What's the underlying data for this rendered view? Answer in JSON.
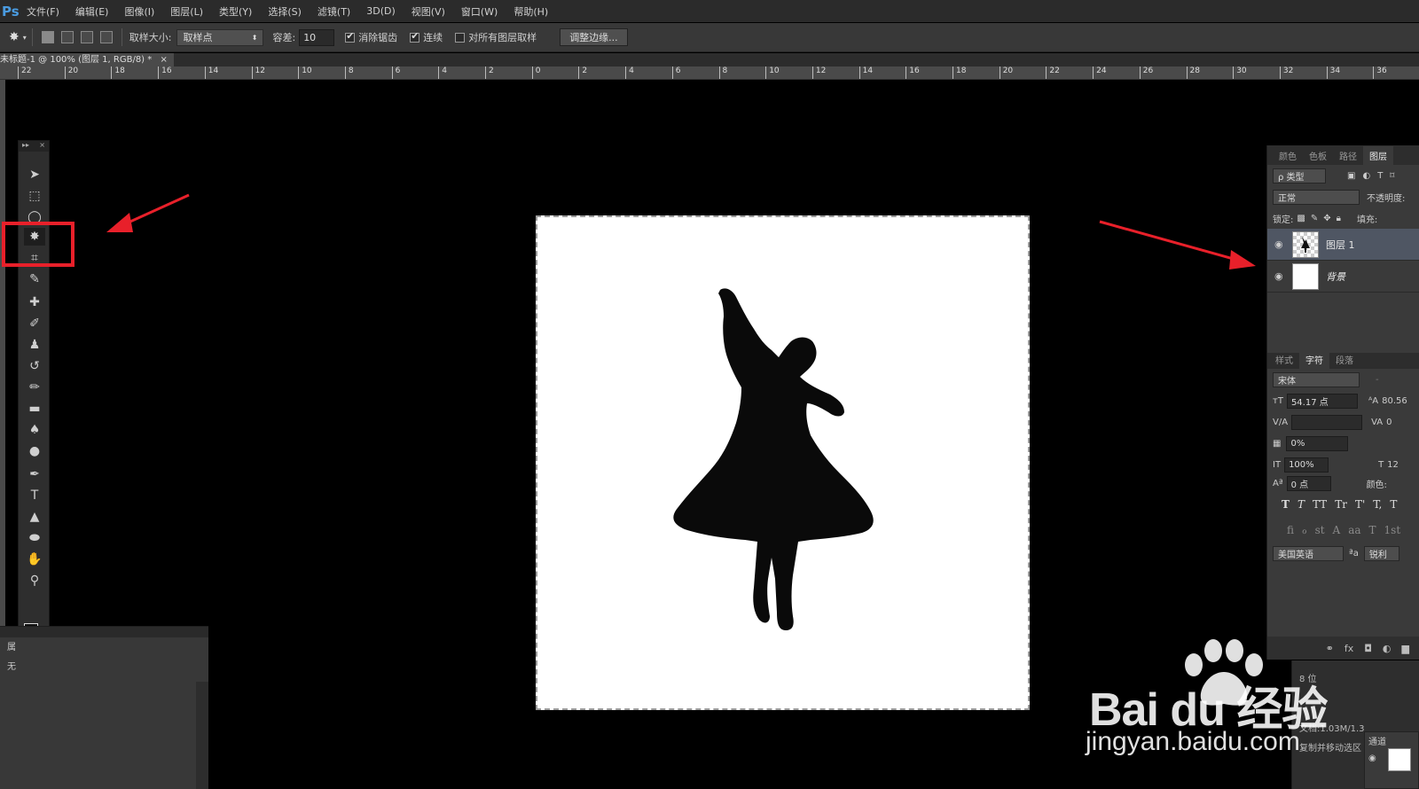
{
  "app": {
    "logo": "Ps"
  },
  "menu": [
    "文件(F)",
    "编辑(E)",
    "图像(I)",
    "图层(L)",
    "类型(Y)",
    "选择(S)",
    "滤镜(T)",
    "3D(D)",
    "视图(V)",
    "窗口(W)",
    "帮助(H)"
  ],
  "options": {
    "sample_size_label": "取样大小:",
    "sample_size_value": "取样点",
    "tolerance_label": "容差:",
    "tolerance_value": "10",
    "antialias_label": "消除锯齿",
    "contiguous_label": "连续",
    "all_layers_label": "对所有图层取样",
    "refine_edge_label": "调整边缘..."
  },
  "document": {
    "tab_title": "未标题-1 @ 100% (图层 1, RGB/8) *",
    "close": "×"
  },
  "ruler": {
    "labels": [
      "22",
      "20",
      "18",
      "16",
      "14",
      "12",
      "10",
      "8",
      "6",
      "4",
      "2",
      "0",
      "2",
      "4",
      "6",
      "8",
      "10",
      "12",
      "14",
      "16",
      "18",
      "20",
      "22",
      "24",
      "26",
      "28",
      "30",
      "32",
      "34",
      "36"
    ]
  },
  "toolbar": {
    "header_left": "▸▸",
    "header_right": "×",
    "tools": [
      {
        "name": "move-tool",
        "glyph": "➤"
      },
      {
        "name": "rect-marquee-tool",
        "glyph": "⬚"
      },
      {
        "name": "lasso-tool",
        "glyph": "◯"
      },
      {
        "name": "magic-wand-tool",
        "glyph": "✸"
      },
      {
        "name": "crop-tool",
        "glyph": "⌗"
      },
      {
        "name": "eyedropper-tool",
        "glyph": "✎"
      },
      {
        "name": "healing-brush-tool",
        "glyph": "✚"
      },
      {
        "name": "brush-tool",
        "glyph": "✐"
      },
      {
        "name": "clone-stamp-tool",
        "glyph": "♟"
      },
      {
        "name": "history-brush-tool",
        "glyph": "↺"
      },
      {
        "name": "eraser-tool",
        "glyph": "✏"
      },
      {
        "name": "gradient-tool",
        "glyph": "▬"
      },
      {
        "name": "blur-tool",
        "glyph": "♠"
      },
      {
        "name": "dodge-tool",
        "glyph": "●"
      },
      {
        "name": "pen-tool",
        "glyph": "✒"
      },
      {
        "name": "type-tool",
        "glyph": "T"
      },
      {
        "name": "path-selection-tool",
        "glyph": "▲"
      },
      {
        "name": "ellipse-tool",
        "glyph": "⬬"
      },
      {
        "name": "hand-tool",
        "glyph": "✋"
      },
      {
        "name": "zoom-tool",
        "glyph": "⚲"
      }
    ],
    "quick_mask_glyph": "◙",
    "screen_mode_glyph": "▭"
  },
  "bottom_left_panel": {
    "label_a": "属",
    "label_b": "无"
  },
  "right_panel": {
    "tabs": [
      "颜色",
      "色板",
      "路径",
      "图层"
    ],
    "filter_kind": "ρ 类型",
    "blend_mode": "正常",
    "opacity_label": "不透明度:",
    "lock_label": "锁定:",
    "fill_label": "填充:",
    "layers": [
      {
        "name": "图层 1",
        "selected": true
      },
      {
        "name": "背景",
        "selected": false
      }
    ],
    "char_tabs": [
      "样式",
      "字符",
      "段落"
    ],
    "font_family": "宋体",
    "font_style": "-",
    "font_size": "54.17 点",
    "leading": "80.56",
    "kerning": "",
    "tracking": "0",
    "scale_pct": "0%",
    "vscale": "100%",
    "hscale": "12",
    "baseline": "0 点",
    "color_label": "颜色:",
    "style_glyphs": [
      "T",
      "T",
      "TT",
      "Tr",
      "T'",
      "T,",
      "T"
    ],
    "opentype_glyphs": [
      "fi",
      "ℴ",
      "st",
      "A",
      "aa",
      "T",
      "1st"
    ],
    "language": "美国英语",
    "aa_label": "ªa",
    "aa_method": "锐利",
    "footer_glyphs": [
      "⚭",
      "fx",
      "◘",
      "◐",
      "▆"
    ]
  },
  "info_panel": {
    "line_a": "8 位",
    "doc_size": "文档:1.03M/1.3",
    "status": "复制并移动选区",
    "channels_tab": "通道"
  },
  "watermark": {
    "brand": "Bai du 经验",
    "url": "jingyan.baidu.com"
  },
  "colors": {
    "highlight": "#e8202a",
    "arrow": "#e8202a"
  }
}
